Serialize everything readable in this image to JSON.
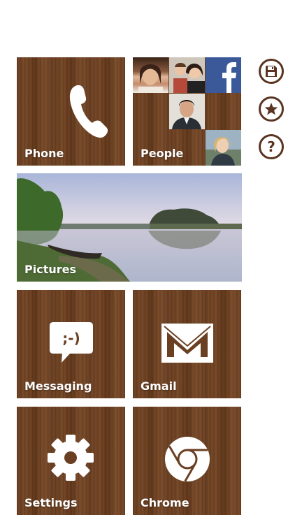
{
  "tiles": {
    "phone": {
      "label": "Phone",
      "icon": "phone-icon"
    },
    "people": {
      "label": "People",
      "icon": "facebook-icon"
    },
    "pictures": {
      "label": "Pictures"
    },
    "messaging": {
      "label": "Messaging",
      "icon": "message-bubble-icon",
      "emoticon": ";-)"
    },
    "gmail": {
      "label": "Gmail",
      "icon": "mail-envelope-icon"
    },
    "settings": {
      "label": "Settings",
      "icon": "gear-icon"
    },
    "chrome": {
      "label": "Chrome",
      "icon": "chrome-icon"
    }
  },
  "side_buttons": [
    {
      "name": "save",
      "icon": "save-icon"
    },
    {
      "name": "favorite",
      "icon": "star-icon"
    },
    {
      "name": "help",
      "icon": "help-icon",
      "glyph": "?"
    }
  ],
  "colors": {
    "wood": "#6b3f22",
    "side_button_outline": "#5a3420",
    "facebook_blue": "#3b5998"
  }
}
